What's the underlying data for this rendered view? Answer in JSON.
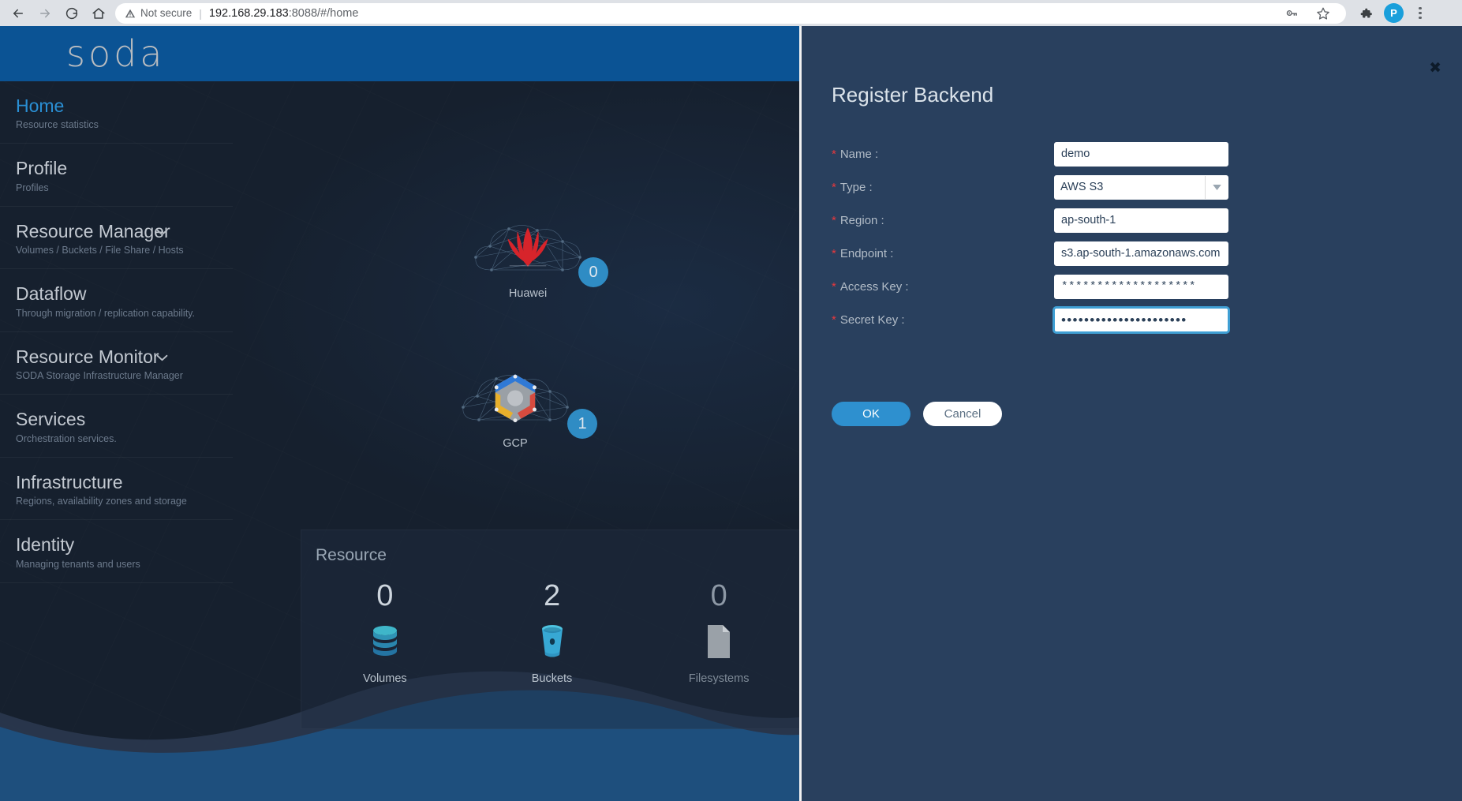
{
  "browser": {
    "back_icon": "arrow-left-icon",
    "forward_icon": "arrow-right-icon",
    "reload_icon": "reload-icon",
    "home_icon": "home-icon",
    "security_label": "Not secure",
    "url_host": "192.168.29.183",
    "url_port": ":8088",
    "url_path": "/#/home",
    "password_key_icon": "key-icon",
    "bookmark_icon": "star-icon",
    "extensions_icon": "puzzle-icon",
    "profile_initial": "P",
    "menu_icon": "kebab-menu-icon"
  },
  "app": {
    "logo_text": "soda",
    "accent_blue": "#0b5394",
    "panel_bg": "#29405e"
  },
  "sidebar": {
    "items": [
      {
        "title": "Home",
        "sub": "Resource statistics",
        "active": true,
        "expandable": false
      },
      {
        "title": "Profile",
        "sub": "Profiles",
        "active": false,
        "expandable": false
      },
      {
        "title": "Resource Manager",
        "sub": "Volumes / Buckets / File Share / Hosts",
        "active": false,
        "expandable": true
      },
      {
        "title": "Dataflow",
        "sub": "Through migration / replication capability.",
        "active": false,
        "expandable": false
      },
      {
        "title": "Resource Monitor",
        "sub": "SODA Storage Infrastructure Manager",
        "active": false,
        "expandable": true
      },
      {
        "title": "Services",
        "sub": "Orchestration services.",
        "active": false,
        "expandable": false
      },
      {
        "title": "Infrastructure",
        "sub": "Regions, availability zones and storage",
        "active": false,
        "expandable": false
      },
      {
        "title": "Identity",
        "sub": "Managing tenants and users",
        "active": false,
        "expandable": false
      }
    ]
  },
  "clouds": [
    {
      "name": "Huawei",
      "count": "0"
    },
    {
      "name": "GCP",
      "count": "1"
    }
  ],
  "resource_card": {
    "title": "Resource",
    "stats": [
      {
        "count": "0",
        "label": "Volumes",
        "icon": "database-stack-icon",
        "dim": false
      },
      {
        "count": "2",
        "label": "Buckets",
        "icon": "bucket-icon",
        "dim": false
      },
      {
        "count": "0",
        "label": "Filesystems",
        "icon": "file-icon",
        "dim": true
      }
    ]
  },
  "panel": {
    "title": "Register Backend",
    "close_icon": "close-icon",
    "fields": [
      {
        "label": "Name :",
        "required": true,
        "kind": "text",
        "value": "demo"
      },
      {
        "label": "Type :",
        "required": true,
        "kind": "select",
        "value": "AWS S3",
        "arrow_icon": "chevron-down-icon"
      },
      {
        "label": "Region :",
        "required": true,
        "kind": "text",
        "value": "ap-south-1"
      },
      {
        "label": "Endpoint :",
        "required": true,
        "kind": "text",
        "value": "s3.ap-south-1.amazonaws.com"
      },
      {
        "label": "Access Key :",
        "required": true,
        "kind": "stars",
        "value": "*******************"
      },
      {
        "label": "Secret Key :",
        "required": true,
        "kind": "dots",
        "value": "••••••••••••••••••••••",
        "focused": true
      }
    ],
    "ok_label": "OK",
    "cancel_label": "Cancel"
  }
}
